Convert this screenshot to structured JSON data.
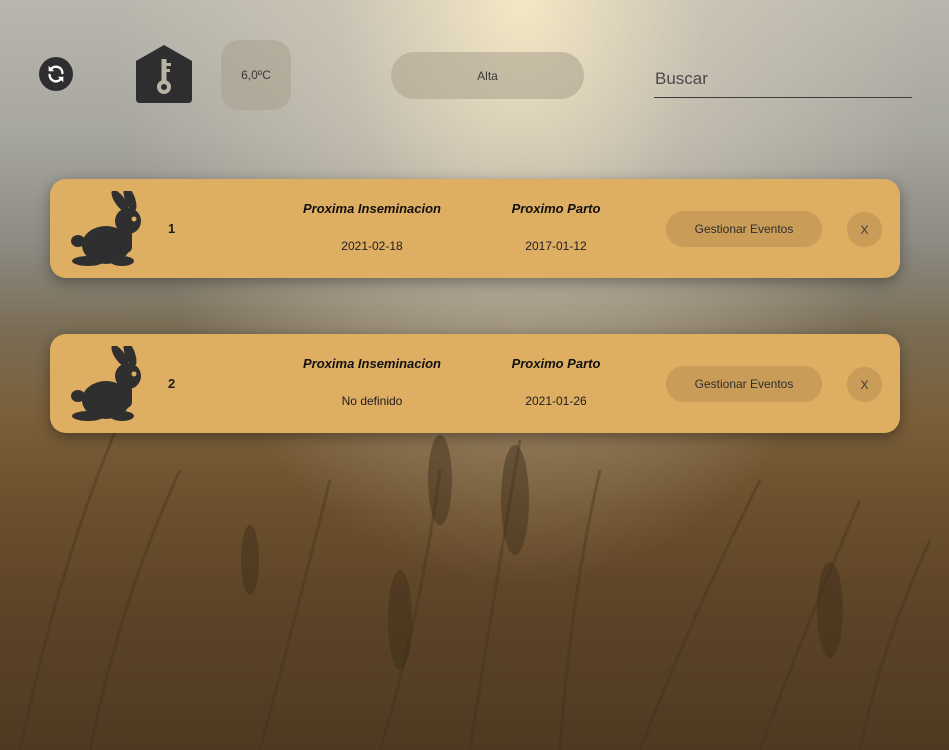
{
  "header": {
    "refresh_icon": "refresh-icon",
    "barn_icon": "barn-key-icon",
    "temperature": "6,0ºC",
    "status_button": "Alta",
    "search_placeholder": "Buscar"
  },
  "cards": [
    {
      "number": "1",
      "icon": "rabbit-icon",
      "next_insemination_label": "Proxima Inseminacion",
      "next_insemination_value": "2021-02-18",
      "next_birth_label": "Proximo Parto",
      "next_birth_value": "2017-01-12",
      "manage_label": "Gestionar Eventos",
      "close_label": "X"
    },
    {
      "number": "2",
      "icon": "rabbit-icon",
      "next_insemination_label": "Proxima Inseminacion",
      "next_insemination_value": "No definido",
      "next_birth_label": "Proximo Parto",
      "next_birth_value": "2021-01-26",
      "manage_label": "Gestionar Eventos",
      "close_label": "X"
    }
  ],
  "colors": {
    "card_background": "#deae62",
    "button_background": "#c99c57",
    "icon_dark": "#2e2e31"
  }
}
